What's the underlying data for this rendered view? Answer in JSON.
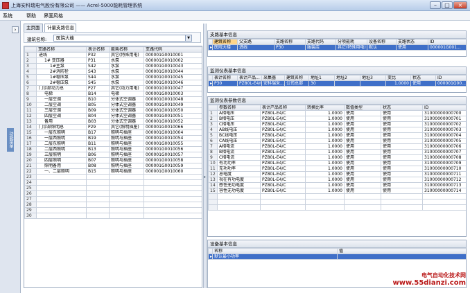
{
  "titlebar": {
    "title": "上海安科瑞电气股份有限公司 —— Acrel-5000能耗管理系统"
  },
  "menu": [
    "系统",
    "帮助",
    "界面风格"
  ],
  "tabs": [
    "主页面",
    "计量支路信息"
  ],
  "search": {
    "label": "建筑名称:",
    "value": "医院大楼"
  },
  "left_grid": {
    "columns": [
      "支路名称",
      "表计名称",
      "能耗名称",
      "支路代码"
    ],
    "rows": [
      [
        "进线",
        "P32",
        "其它(特殊用电)",
        "000001G0010001"
      ],
      [
        "1# 变压器",
        "P31",
        "水泵",
        "000001G0010002"
      ],
      [
        "1#主泵",
        "S42",
        "水泵",
        "000001G0010043"
      ],
      [
        "2#消防栓",
        "S43",
        "水泵",
        "000001G0010044"
      ],
      [
        "1#稳压泵",
        "S44",
        "水泵",
        "000001G0010045"
      ],
      [
        "2#稳压泵",
        "S45",
        "水泵",
        "000001G0010046"
      ],
      [
        "门诊部动力总",
        "P27",
        "其它(动力用电)",
        "000001G0010047"
      ],
      [
        "电梯",
        "B14",
        "电梯",
        "000001G0010003"
      ],
      [
        "一层空调",
        "B10",
        "分体式空调器",
        "000001G0010048"
      ],
      [
        "二层空调",
        "B05",
        "分体式空调器",
        "000001G0010049"
      ],
      [
        "三层空调",
        "B09",
        "分体式空调器",
        "000001G0010050"
      ],
      [
        "四层空调",
        "B04",
        "分体式空调器",
        "000001G0010051"
      ],
      [
        "备用",
        "B03",
        "分体式空调器",
        "000001G0010052"
      ],
      [
        "门诊部照明总",
        "P29",
        "其它(照明插座)",
        "000001G0010066"
      ],
      [
        "一层东照明",
        "B17",
        "照明与插座",
        "000001G0010004"
      ],
      [
        "一层西照明",
        "B19",
        "照明与插座",
        "000001G0010054"
      ],
      [
        "二层东照明",
        "B11",
        "照明与插座",
        "000001G0010055"
      ],
      [
        "二层西照明",
        "B13",
        "照明与插座",
        "000001G0010056"
      ],
      [
        "三层照明",
        "B06",
        "照明与插座",
        "000001G0010057"
      ],
      [
        "四层照明",
        "B07",
        "照明与插座",
        "000001G0010058"
      ],
      [
        "照明备用",
        "B08",
        "照明与插座",
        "000001G0010059"
      ],
      [
        "一、二层照明",
        "B15",
        "照明与插座",
        "000001G0010060"
      ]
    ],
    "indent": [
      0,
      1,
      2,
      2,
      2,
      2,
      0,
      1,
      1,
      1,
      1,
      1,
      1,
      0,
      1,
      1,
      1,
      1,
      1,
      1,
      1,
      1
    ]
  },
  "branch_panel": {
    "title": "支路基本信息",
    "columns": [
      "建筑名称",
      "父支路",
      "支路名称",
      "支路代码",
      "分项能耗",
      "设备名称",
      "支路状态",
      "ID"
    ],
    "row": [
      "医院大楼",
      "进线",
      "P30",
      "服装店",
      "其它(特殊用电)",
      "默认",
      "使用",
      "000001G001..."
    ]
  },
  "meter_panel": {
    "title": "监测仪表基本信息",
    "columns": [
      "表计名称",
      "表计产品...",
      "采集器",
      "建筑名称",
      "地址1",
      "地址2",
      "地址3",
      "变比",
      "状态",
      "ID"
    ],
    "row": [
      "P30",
      "PZ80L-E4/C",
      "安科瑞采...",
      "公司总部",
      "30",
      "",
      "",
      "1.0000",
      "使用",
      "000001G00..."
    ]
  },
  "param_panel": {
    "title": "监测仪表参数信息",
    "columns": [
      "参数名称",
      "表计产品名称",
      "转换比率",
      "数值类型",
      "状态",
      "ID"
    ],
    "rows": [
      [
        "A相电压",
        "PZ80L-E4/C",
        "1.0000",
        "使用",
        "使用",
        "31000000000700"
      ],
      [
        "B相电压",
        "PZ80L-E4/C",
        "1.0000",
        "使用",
        "使用",
        "31000000000701"
      ],
      [
        "C相电压",
        "PZ80L-E4/C",
        "1.0000",
        "使用",
        "使用",
        "31000000000702"
      ],
      [
        "AB线电压",
        "PZ80L-E4/C",
        "1.0000",
        "使用",
        "使用",
        "31000000000703"
      ],
      [
        "BC线电压",
        "PZ80L-E4/C",
        "1.0000",
        "使用",
        "使用",
        "31000000000704"
      ],
      [
        "CA线电压",
        "PZ80L-E4/C",
        "1.0000",
        "使用",
        "使用",
        "31000000000705"
      ],
      [
        "A相电流",
        "PZ80L-E4/C",
        "1.0000",
        "使用",
        "使用",
        "31000000000706"
      ],
      [
        "B相电流",
        "PZ80L-E4/C",
        "1.0000",
        "使用",
        "使用",
        "31000000000707"
      ],
      [
        "C相电流",
        "PZ80L-E4/C",
        "1.0000",
        "使用",
        "使用",
        "31000000000708"
      ],
      [
        "有功功率",
        "PZ80L-E4/C",
        "1.0000",
        "使用",
        "使用",
        "31000000000709"
      ],
      [
        "无功功率",
        "PZ80L-E4/C",
        "1.0000",
        "使用",
        "使用",
        "31000000000710"
      ],
      [
        "总电度",
        "PZ80L-E4/C",
        "1.0000",
        "使用",
        "使用",
        "31000000000711"
      ],
      [
        "视在有功电度",
        "PZ80L-E4/C",
        "1.0000",
        "使用",
        "使用",
        "31000000000712"
      ],
      [
        "感性无功电度",
        "PZ80L-E4/C",
        "1.0000",
        "使用",
        "使用",
        "31000000000713"
      ],
      [
        "容性无功电度",
        "PZ80L-E4/C",
        "1.0000",
        "使用",
        "使用",
        "31000000000714"
      ]
    ]
  },
  "device_panel": {
    "title": "设备基本信息",
    "columns": [
      "名称",
      "值"
    ],
    "row": [
      "默认最小功率",
      ""
    ]
  },
  "watermark": {
    "line1": "电气自动化技术网",
    "line2": "www.55dianzi.com"
  },
  "left_strip": {
    "label": "功能菜单"
  }
}
